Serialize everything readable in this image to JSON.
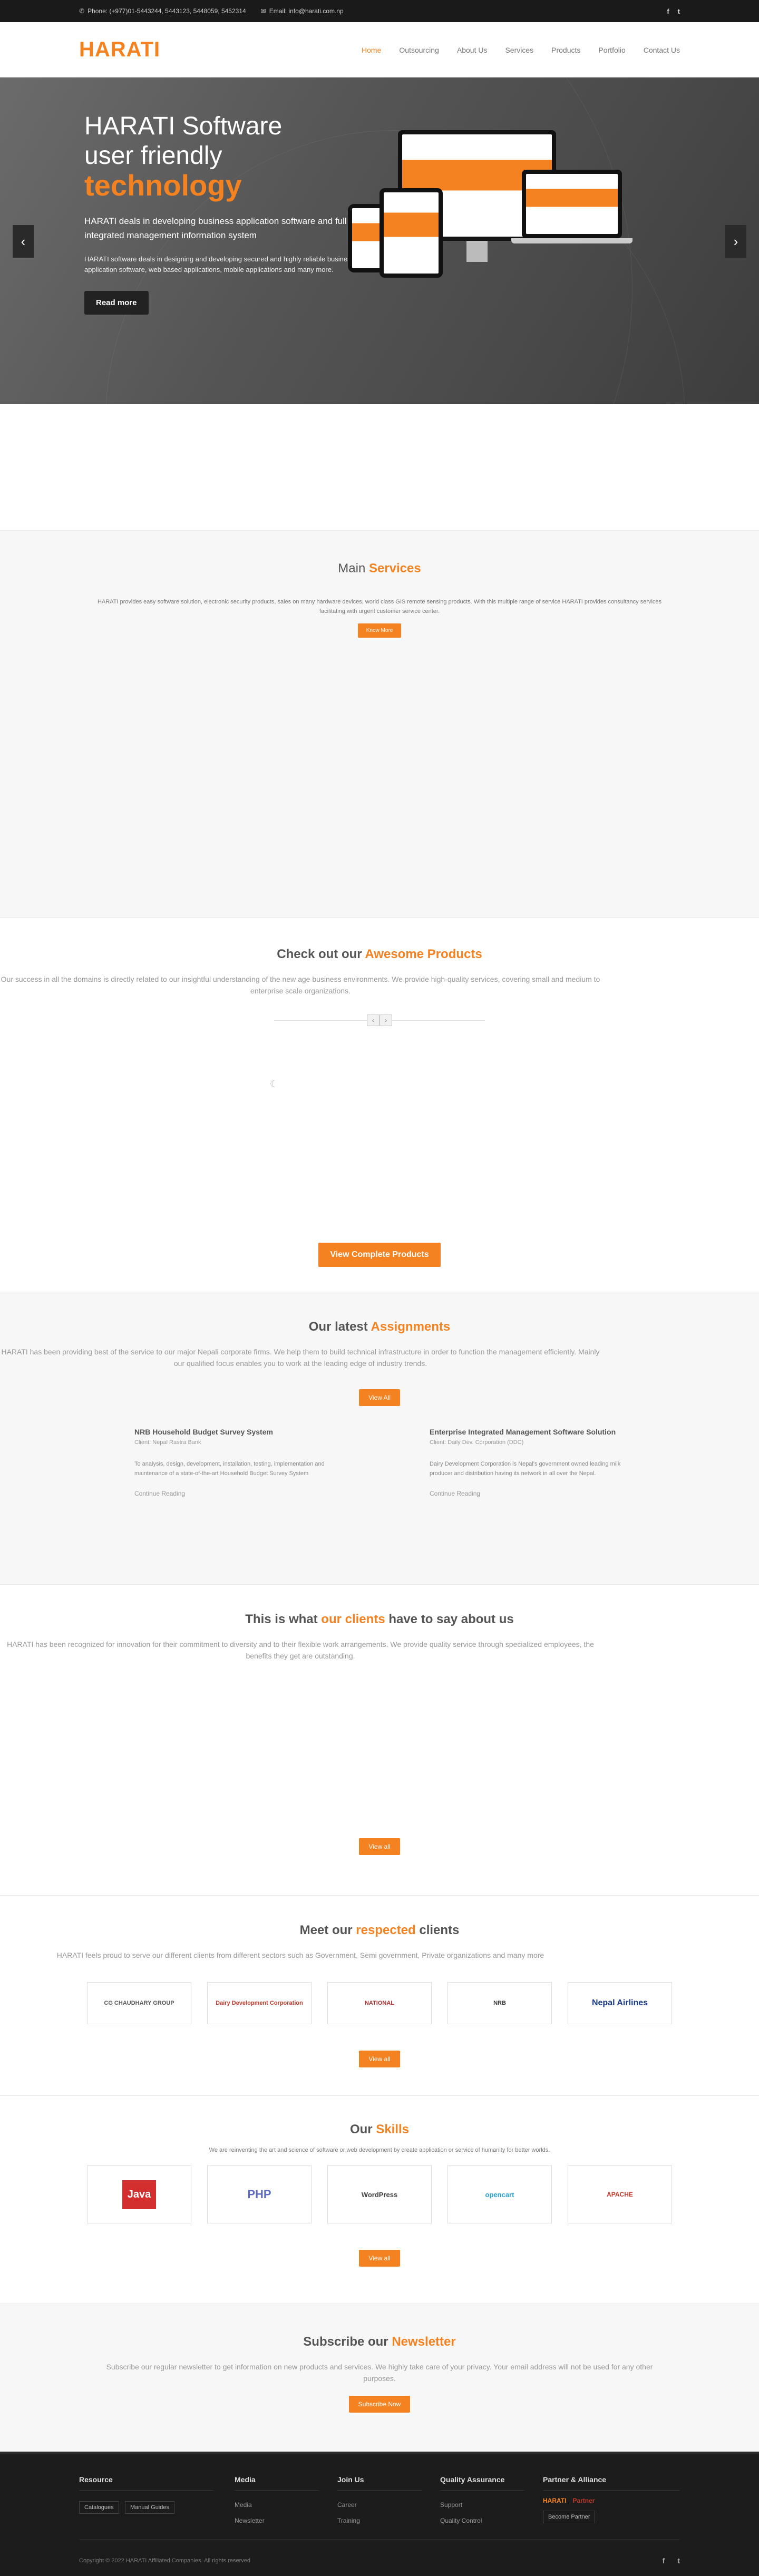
{
  "topbar": {
    "phone": "Phone: (+977)01-5443244, 5443123, 5448059, 5452314",
    "email": "Email: info@harati.com.np"
  },
  "header": {
    "logo": "HARATI",
    "nav": [
      "Home",
      "Outsourcing",
      "About Us",
      "Services",
      "Products",
      "Portfolio",
      "Contact Us"
    ]
  },
  "hero": {
    "title_line1": "HARATI Software",
    "title_line2": "user friendly ",
    "title_highlight": "technology",
    "lead": "HARATI deals in developing business application software and full fledge integrated management information system",
    "sub": "HARATI software deals in designing and developing secured and highly reliable business application software, web based applications, mobile applications and many more.",
    "button": "Read more"
  },
  "services": {
    "title_a": "Main ",
    "title_b": "Services",
    "desc": "HARATI provides easy software solution, electronic security products, sales on many hardware devices, world class GIS remote sensing products. With this multiple range of service HARATI provides consultancy services facilitating with urgent customer service center.",
    "button": "Know More"
  },
  "products": {
    "title_a": "Check out our ",
    "title_b": "Awesome Products",
    "desc": "Our success in all the domains is directly related to our insightful understanding of the new age business environments. We provide high-quality services, covering small and medium to enterprise scale organizations.",
    "button": "View Complete Products"
  },
  "assignments": {
    "title_a": "Our latest ",
    "title_b": "Assignments",
    "desc": "HARATI has been providing best of the service to our major Nepali corporate firms. We help them to build technical infrastructure in order to function the management efficiently. Mainly our qualified focus enables you to work at the leading edge of industry trends.",
    "button": "View All",
    "items": [
      {
        "title": "NRB Household Budget Survey System",
        "client": "Client: Nepal Rastra Bank",
        "text": "To analysis, design, development, installation, testing, implementation and maintenance of a state-of-the-art Household Budget Survey System",
        "more": "Continue Reading"
      },
      {
        "title": "Enterprise Integrated Management Software Solution",
        "client": "Client: Daily Dev. Corporation (DDC)",
        "text": "Dairy Development Corporation is Nepal's government owned leading milk producer and distribution having its network in all over the Nepal.",
        "more": "Continue Reading"
      }
    ]
  },
  "testimonials": {
    "title_a": "This is what ",
    "title_b": "our clients",
    "title_c": " have to say about us",
    "desc": "HARATI has been recognized for innovation for their commitment to diversity and to their flexible work arrangements. We provide quality service through specialized employees, the benefits they get are outstanding.",
    "button": "View all"
  },
  "clients": {
    "title_a": "Meet our ",
    "title_b": "respected",
    "title_c": " clients",
    "desc": "HARATI feels proud to serve our different clients from different sectors such as Government, Semi government, Private organizations and many more",
    "logos": [
      "CG CHAUDHARY GROUP",
      "Dairy Development Corporation",
      "NATIONAL",
      "NRB",
      "Nepal Airlines"
    ],
    "button": "View all"
  },
  "skills": {
    "title_a": "Our ",
    "title_b": "Skills",
    "desc": "We are reinventing the art and science of software or web development by create application or service of humanity for better worlds.",
    "logos": [
      "Java",
      "PHP",
      "WordPress",
      "opencart",
      "APACHE"
    ],
    "button": "View all"
  },
  "newsletter": {
    "title_a": "Subscribe our ",
    "title_b": "Newsletter",
    "desc": "Subscribe our regular newsletter to get information on new products and services. We highly take care of your privacy. Your email address will not be used for any other purposes.",
    "button": "Subscribe Now"
  },
  "footer": {
    "resource": {
      "title": "Resource",
      "tags": [
        "Catalogues",
        "Manual Guides"
      ]
    },
    "media": {
      "title": "Media",
      "links": [
        "Media",
        "Newsletter"
      ]
    },
    "join": {
      "title": "Join Us",
      "links": [
        "Career",
        "Training"
      ]
    },
    "quality": {
      "title": "Quality Assurance",
      "links": [
        "Support",
        "Quality Control"
      ]
    },
    "partner": {
      "title": "Partner & Alliance",
      "logos": [
        "HARATI",
        "Partner"
      ],
      "button": "Become Partner"
    },
    "copyright": "Copyright © 2022 HARATI Affiliated Companies. All rights reserved"
  },
  "colors": {
    "accent": "#f58220",
    "dark": "#1a1a1a"
  }
}
